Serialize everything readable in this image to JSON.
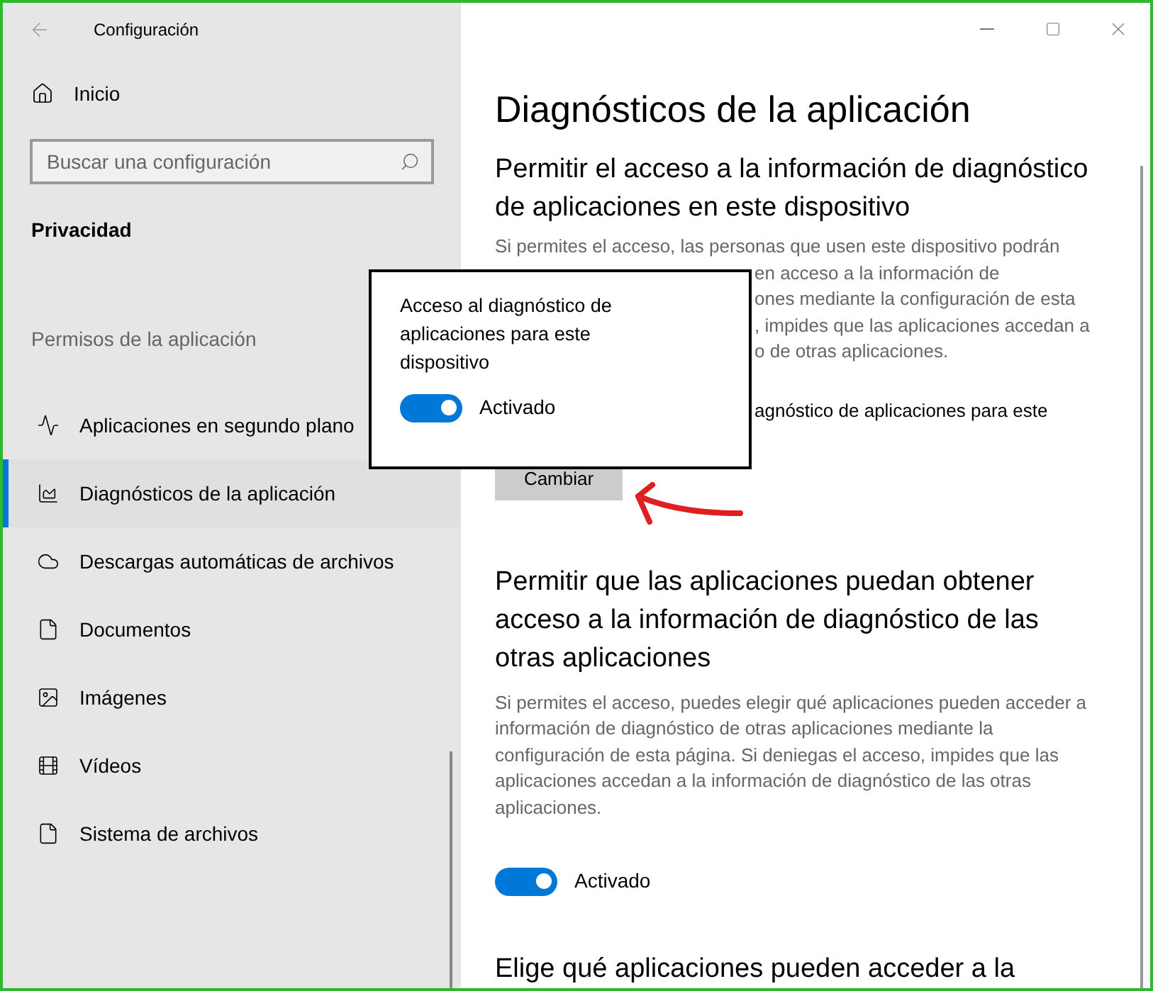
{
  "window": {
    "title": "Configuración"
  },
  "sidebar": {
    "home": "Inicio",
    "search": {
      "placeholder": "Buscar una configuración"
    },
    "section": "Privacidad",
    "group": "Permisos de la aplicación",
    "items": [
      {
        "label": "Aplicaciones en segundo plano",
        "kind": "activity",
        "selected": false
      },
      {
        "label": "Diagnósticos de la aplicación",
        "kind": "chart",
        "selected": true
      },
      {
        "label": "Descargas automáticas de archivos",
        "kind": "cloud",
        "selected": false
      },
      {
        "label": "Documentos",
        "kind": "file",
        "selected": false
      },
      {
        "label": "Imágenes",
        "kind": "image",
        "selected": false
      },
      {
        "label": "Vídeos",
        "kind": "film",
        "selected": false
      },
      {
        "label": "Sistema de archivos",
        "kind": "file",
        "selected": false
      }
    ]
  },
  "content": {
    "title": "Diagnósticos de la aplicación",
    "section_1": {
      "heading": "Permitir el acceso a la información de diagnóstico de aplicaciones en este dispositivo",
      "description_lines": [
        "Si permites el acceso, las personas que usen este dispositivo podrán",
        "en acceso a la información de",
        "ones mediante la configuración de esta",
        ", impides que las aplicaciones accedan a",
        "o de otras aplicaciones."
      ],
      "status": "agnóstico de aplicaciones para este",
      "button": "Cambiar"
    },
    "section_2": {
      "heading": "Permitir que las aplicaciones puedan obtener acceso a la información de diagnóstico de las otras aplicaciones",
      "description": "Si permites el acceso, puedes elegir qué aplicaciones pueden acceder a información de diagnóstico de otras aplicaciones mediante la configuración de esta página. Si deniegas el acceso, impides que las aplicaciones accedan a la información de diagnóstico de las otras aplicaciones.",
      "toggle": {
        "on": true,
        "label": "Activado"
      }
    },
    "section_3": {
      "heading": "Elige qué aplicaciones pueden acceder a la"
    }
  },
  "popup": {
    "title": "Acceso al diagnóstico de aplicaciones para este dispositivo",
    "toggle": {
      "on": true,
      "label": "Activado"
    }
  }
}
